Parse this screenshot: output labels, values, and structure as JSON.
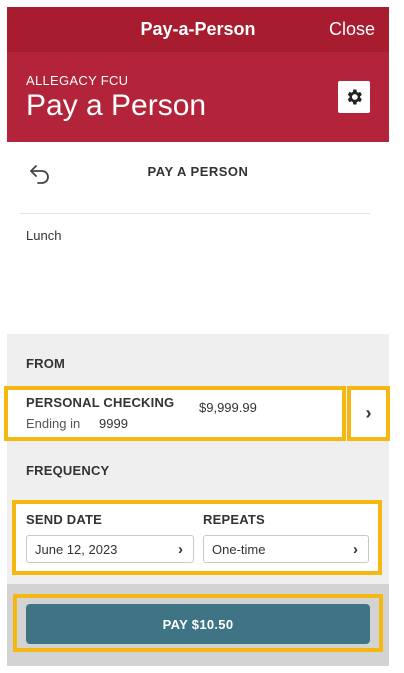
{
  "topbar": {
    "title": "Pay-a-Person",
    "close_label": "Close"
  },
  "header": {
    "institution": "ALLEGACY FCU",
    "page_title": "Pay a Person"
  },
  "subheader": {
    "title": "PAY A PERSON"
  },
  "memo": "Lunch",
  "from": {
    "label": "FROM",
    "account_name": "PERSONAL CHECKING",
    "ending_label": "Ending in",
    "ending_number": "9999",
    "balance": "$9,999.99"
  },
  "frequency": {
    "label": "FREQUENCY",
    "send_date_label": "SEND DATE",
    "send_date_value": "June 12, 2023",
    "repeats_label": "REPEATS",
    "repeats_value": "One-time"
  },
  "pay_button": {
    "label": "PAY $10.50"
  },
  "colors": {
    "brand_red": "#a71c2e",
    "highlight": "#f4b811",
    "pay_button": "#3e7483"
  },
  "icons": {
    "settings": "gear-icon",
    "back": "back-arrow-icon",
    "chevron": "chevron-right-icon"
  }
}
